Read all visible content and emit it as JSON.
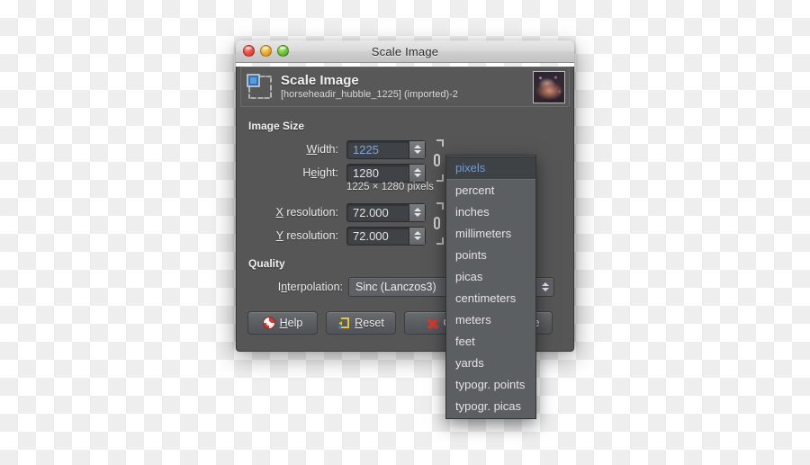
{
  "window": {
    "title": "Scale Image",
    "traffic_lights": [
      "close-button",
      "minimize-button",
      "zoom-button"
    ]
  },
  "header": {
    "icon": "scale-image-icon",
    "title": "Scale Image",
    "subtitle": "[horseheadir_hubble_1225] (imported)-2",
    "thumbnail": "image-thumbnail"
  },
  "image_size": {
    "section_label": "Image Size",
    "width": {
      "label": "Width:",
      "accel": "W",
      "value": "1225"
    },
    "height": {
      "label": "Height:",
      "accel": "e",
      "value": "1280"
    },
    "dimensions_note": "1225 × 1280 pixels",
    "x_resolution": {
      "label": "X resolution:",
      "accel": "X",
      "value": "72.000"
    },
    "y_resolution": {
      "label": "Y resolution:",
      "accel": "Y",
      "value": "72.000"
    }
  },
  "quality": {
    "section_label": "Quality",
    "interpolation": {
      "label": "Interpolation:",
      "accel": "n",
      "value": "Sinc (Lanczos3)"
    }
  },
  "buttons": {
    "help": {
      "label": "Help",
      "accel": "H",
      "icon": "lifering-icon"
    },
    "reset": {
      "label": "Reset",
      "accel": "R",
      "icon": "revert-arrow-icon"
    },
    "cancel": {
      "label": "Cancel",
      "visible_text": "C",
      "accel": "C",
      "icon": "red-x-icon"
    },
    "scale": {
      "label": "Scale",
      "visible_text": "cale"
    }
  },
  "unit_dropdown": {
    "selected": "pixels",
    "items": [
      "pixels",
      "percent",
      "inches",
      "millimeters",
      "points",
      "picas",
      "centimeters",
      "meters",
      "feet",
      "yards",
      "typogr. points",
      "typogr. picas"
    ]
  },
  "colors": {
    "dialog_bg": "#565656",
    "field_bg": "#3f4246",
    "selected_text": "#6f9ad4",
    "titlebar": "#d6d6d6"
  }
}
